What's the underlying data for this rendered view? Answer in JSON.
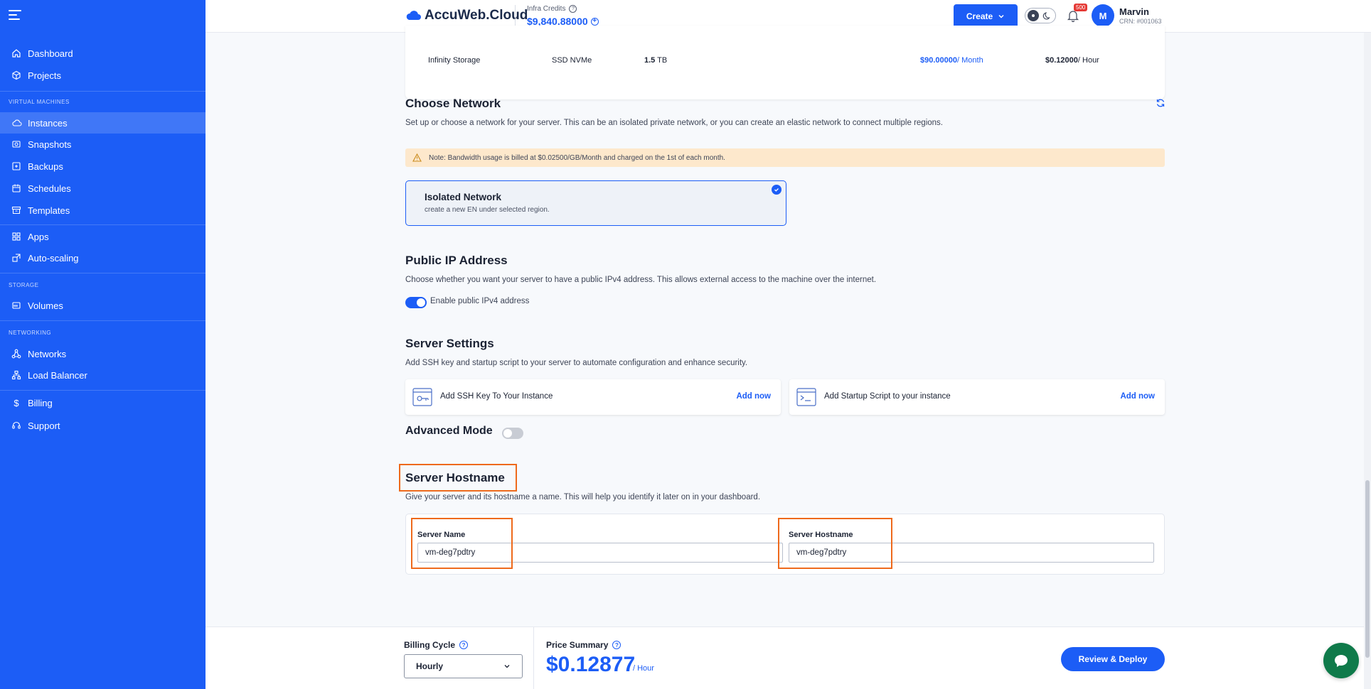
{
  "sidebar": {
    "items": [
      {
        "label": "Dashboard",
        "icon": "home-icon"
      },
      {
        "label": "Projects",
        "icon": "cube-icon"
      },
      {
        "label": "Instances",
        "icon": "cloud-icon"
      },
      {
        "label": "Snapshots",
        "icon": "snapshot-icon"
      },
      {
        "label": "Backups",
        "icon": "backup-icon"
      },
      {
        "label": "Schedules",
        "icon": "calendar-icon"
      },
      {
        "label": "Templates",
        "icon": "archive-icon"
      },
      {
        "label": "Apps",
        "icon": "grid-icon"
      },
      {
        "label": "Auto-scaling",
        "icon": "scaling-icon"
      },
      {
        "label": "Volumes",
        "icon": "volume-icon"
      },
      {
        "label": "Networks",
        "icon": "network-icon"
      },
      {
        "label": "Load Balancer",
        "icon": "load-balancer-icon"
      },
      {
        "label": "Billing",
        "icon": "dollar-icon"
      },
      {
        "label": "Support",
        "icon": "headset-icon"
      }
    ],
    "sections": {
      "vm": "VIRTUAL MACHINES",
      "storage": "STORAGE",
      "networking": "NETWORKING"
    },
    "active": "Instances"
  },
  "header": {
    "logo": "AccuWeb.Cloud",
    "credits_label": "Infra Credits",
    "credits_value": "$9,840.88000",
    "create_label": "Create",
    "notification_count": "500",
    "avatar_initial": "M",
    "user_name": "Marvin",
    "user_crn": "CRN: #001063"
  },
  "storage_row": {
    "name": "Infinity Storage",
    "type": "SSD NVMe",
    "size_value": "1.5",
    "size_unit": "TB",
    "monthly_price": "$90.00000",
    "monthly_unit": "/ Month",
    "hourly_price": "$0.12000",
    "hourly_unit": "/ Hour"
  },
  "network": {
    "title": "Choose Network",
    "description": "Set up or choose a network for your server. This can be an isolated private network, or you can create an elastic network to connect multiple regions.",
    "notice": "Note: Bandwidth usage is billed at $0.02500/GB/Month and charged on the 1st of each month.",
    "option_title": "Isolated Network",
    "option_subtitle": "create a new EN under selected region."
  },
  "public_ip": {
    "title": "Public IP Address",
    "description": "Choose whether you want your server to have a public IPv4 address. This allows external access to the machine over the internet.",
    "toggle_label": "Enable public IPv4 address",
    "enabled": true
  },
  "server_settings": {
    "title": "Server Settings",
    "description": "Add SSH key and startup script to your server to automate configuration and enhance security.",
    "ssh_label": "Add SSH Key To Your Instance",
    "script_label": "Add Startup Script to your instance",
    "action_label": "Add now"
  },
  "advanced": {
    "label": "Advanced Mode",
    "enabled": false
  },
  "hostname": {
    "title": "Server Hostname",
    "description": "Give your server and its hostname a name. This will help you identify it later on in your dashboard.",
    "name_label": "Server Name",
    "name_value": "vm-deg7pdtry",
    "hostname_label": "Server Hostname",
    "hostname_value": "vm-deg7pdtry"
  },
  "footer": {
    "billing_cycle_label": "Billing Cycle",
    "billing_cycle_value": "Hourly",
    "price_summary_label": "Price Summary",
    "price_value": "$0.12877",
    "price_unit": "/ Hour",
    "deploy_label": "Review & Deploy"
  },
  "colors": {
    "primary": "#1c5df6",
    "highlight": "#ee6a1c",
    "notice_bg": "#fde8cc",
    "chat": "#0f7a4a"
  }
}
